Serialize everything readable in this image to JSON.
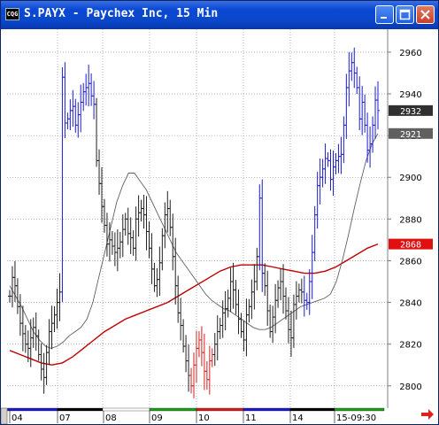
{
  "window": {
    "title": "S.PAYX - Paychex Inc, 15 Min",
    "icon_text": "CQG"
  },
  "colors": {
    "up_bar": "#1c1ccf",
    "down_bar": "#d22020",
    "neutral_bar": "#202020",
    "ma_short": "#606060",
    "ma_long": "#c00000"
  },
  "price_tags": [
    {
      "text": "2932",
      "value": 2932,
      "bg": "#303030"
    },
    {
      "text": "2921",
      "value": 2921,
      "bg": "#606060"
    },
    {
      "text": "2868",
      "value": 2868,
      "bg": "#e01010"
    }
  ],
  "chart_data": {
    "type": "line",
    "y_ticks": [
      "2960",
      "2940",
      "2920",
      "2900",
      "2880",
      "2860",
      "2840",
      "2820",
      "2800"
    ],
    "ylim": [
      2791,
      2971
    ],
    "x_labels": [
      "04",
      "07",
      "08",
      "09",
      "10",
      "11",
      "14",
      "15-09:30"
    ],
    "series": [
      {
        "style": "bars",
        "values": [
          2843,
          2852,
          2848,
          2838,
          2830,
          2825,
          2820,
          2818,
          2823,
          2828,
          2824,
          2815,
          2808,
          2804,
          2816,
          2826,
          2830,
          2834,
          2840,
          2845,
          2948,
          2926,
          2928,
          2932,
          2934,
          2925,
          2930,
          2936,
          2941,
          2943,
          2945,
          2939,
          2935,
          2908,
          2897,
          2886,
          2877,
          2868,
          2870,
          2867,
          2864,
          2866,
          2869,
          2875,
          2880,
          2873,
          2871,
          2866,
          2880,
          2883,
          2885,
          2882,
          2874,
          2866,
          2856,
          2848,
          2851,
          2859,
          2872,
          2882,
          2885,
          2876,
          2862,
          2848,
          2835,
          2829,
          2819,
          2812,
          2805,
          2800,
          2810,
          2818,
          2822,
          2816,
          2807,
          2803,
          2812,
          2815,
          2820,
          2826,
          2829,
          2835,
          2837,
          2842,
          2850,
          2846,
          2839,
          2832,
          2826,
          2822,
          2834,
          2838,
          2845,
          2850,
          2862,
          2890,
          2854,
          2848,
          2836,
          2826,
          2833,
          2841,
          2847,
          2850,
          2843,
          2836,
          2827,
          2823,
          2839,
          2843,
          2846,
          2845,
          2841,
          2840,
          2850,
          2864,
          2882,
          2896,
          2900,
          2904,
          2909,
          2908,
          2899,
          2905,
          2908,
          2910,
          2911,
          2925,
          2943,
          2951,
          2955,
          2950,
          2943,
          2928,
          2936,
          2925,
          2913,
          2916,
          2925,
          2937,
          2932
        ]
      },
      {
        "style": "moving-average-short",
        "values": [
          2848,
          2843,
          2838,
          2832,
          2826,
          2822,
          2819,
          2818,
          2819,
          2821,
          2824,
          2826,
          2828,
          2832,
          2840,
          2852,
          2864,
          2876,
          2888,
          2896,
          2902,
          2902,
          2898,
          2894,
          2888,
          2882,
          2876,
          2870,
          2864,
          2860,
          2856,
          2852,
          2848,
          2844,
          2841,
          2839,
          2837,
          2836,
          2834,
          2832,
          2830,
          2828,
          2827,
          2827,
          2828,
          2830,
          2832,
          2834,
          2836,
          2838,
          2839,
          2840,
          2841,
          2842,
          2844,
          2850,
          2860,
          2872,
          2885,
          2897,
          2908,
          2916,
          2921
        ]
      },
      {
        "style": "moving-average-long",
        "values": [
          2817,
          2815,
          2813,
          2811,
          2810,
          2811,
          2814,
          2818,
          2822,
          2826,
          2829,
          2832,
          2834,
          2836,
          2838,
          2840,
          2843,
          2846,
          2849,
          2852,
          2855,
          2857,
          2858,
          2858,
          2858,
          2857,
          2856,
          2855,
          2854,
          2854,
          2855,
          2857,
          2860,
          2863,
          2866,
          2868
        ]
      }
    ]
  }
}
